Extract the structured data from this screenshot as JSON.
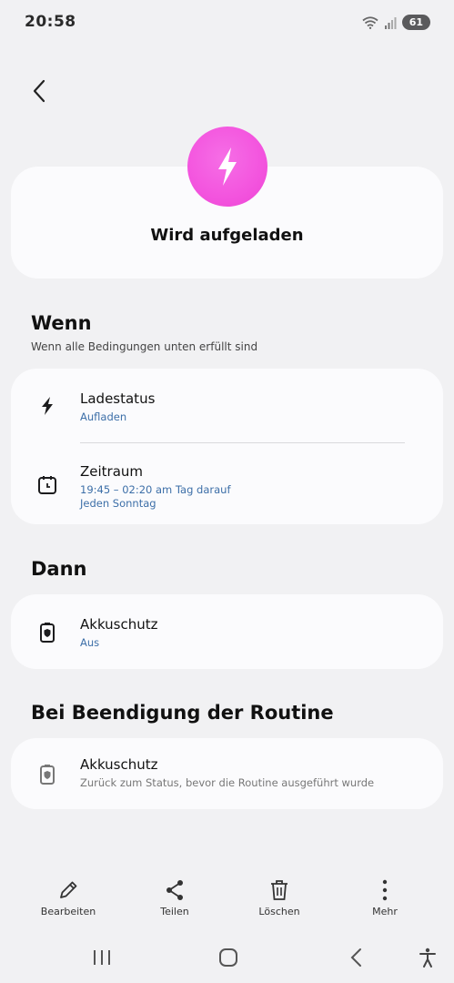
{
  "status": {
    "time": "20:58",
    "battery": "61"
  },
  "header": {
    "title": "Wird aufgeladen",
    "icon": "bolt-icon",
    "icon_color": "#f354de"
  },
  "wenn": {
    "title": "Wenn",
    "subtitle": "Wenn alle Bedingungen unten erfüllt sind",
    "items": [
      {
        "title": "Ladestatus",
        "sub": "Aufladen",
        "icon": "bolt-icon"
      },
      {
        "title": "Zeitraum",
        "sub1": "19:45 – 02:20 am Tag darauf",
        "sub2": "Jeden Sonntag",
        "icon": "calendar-clock-icon"
      }
    ]
  },
  "dann": {
    "title": "Dann",
    "items": [
      {
        "title": "Akkuschutz",
        "sub": "Aus",
        "icon": "battery-shield-icon"
      }
    ]
  },
  "ende": {
    "title": "Bei Beendigung der Routine",
    "items": [
      {
        "title": "Akkuschutz",
        "sub": "Zurück zum Status, bevor die Routine ausgeführt wurde",
        "icon": "battery-shield-icon"
      }
    ]
  },
  "bottom_bar": {
    "edit": "Bearbeiten",
    "share": "Teilen",
    "delete": "Löschen",
    "more": "Mehr"
  },
  "colors": {
    "background": "#f1f1f3",
    "card": "#fbfbfd",
    "link": "#3d6fa8"
  }
}
